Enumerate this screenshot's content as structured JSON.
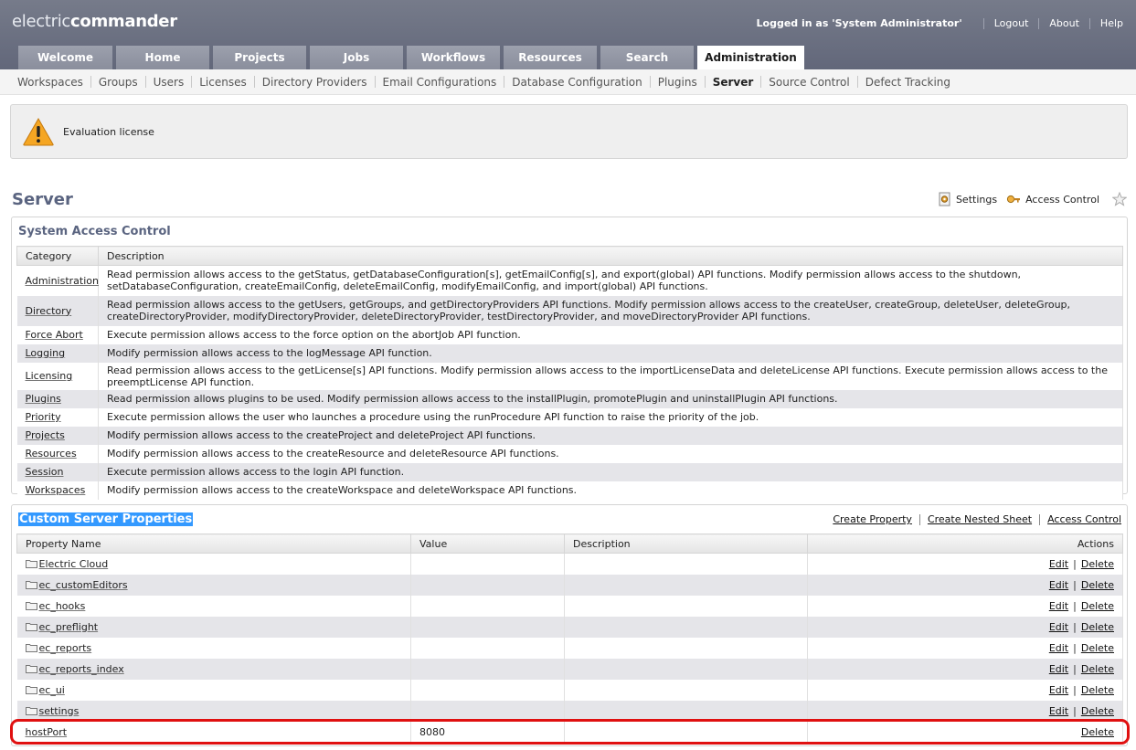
{
  "app": {
    "logo_light": "electric",
    "logo_bold": "commander"
  },
  "header": {
    "user_text": "Logged in as 'System Administrator'",
    "links": [
      "Logout",
      "About",
      "Help"
    ]
  },
  "tabs": [
    {
      "label": "Welcome",
      "active": false
    },
    {
      "label": "Home",
      "active": false
    },
    {
      "label": "Projects",
      "active": false
    },
    {
      "label": "Jobs",
      "active": false
    },
    {
      "label": "Workflows",
      "active": false
    },
    {
      "label": "Resources",
      "active": false
    },
    {
      "label": "Search",
      "active": false
    },
    {
      "label": "Administration",
      "active": true
    }
  ],
  "subnav": [
    {
      "label": "Workspaces",
      "active": false
    },
    {
      "label": "Groups",
      "active": false
    },
    {
      "label": "Users",
      "active": false
    },
    {
      "label": "Licenses",
      "active": false
    },
    {
      "label": "Directory Providers",
      "active": false
    },
    {
      "label": "Email Configurations",
      "active": false
    },
    {
      "label": "Database Configuration",
      "active": false
    },
    {
      "label": "Plugins",
      "active": false
    },
    {
      "label": "Server",
      "active": true
    },
    {
      "label": "Source Control",
      "active": false
    },
    {
      "label": "Defect Tracking",
      "active": false
    }
  ],
  "banner": {
    "message": "Evaluation license",
    "icon": "warning-icon"
  },
  "page": {
    "title": "Server",
    "settings_label": "Settings",
    "access_control_label": "Access Control"
  },
  "access": {
    "title": "System Access Control",
    "columns": [
      "Category",
      "Description"
    ],
    "rows": [
      {
        "category": "Administration",
        "description": "Read permission allows access to the getStatus, getDatabaseConfiguration[s], getEmailConfig[s], and export(global) API functions. Modify permission allows access to the shutdown, setDatabaseConfiguration, createEmailConfig, deleteEmailConfig, modifyEmailConfig, and import(global) API functions."
      },
      {
        "category": "Directory",
        "description": "Read permission allows access to the getUsers, getGroups, and getDirectoryProviders API functions. Modify permission allows access to the createUser, createGroup, deleteUser, deleteGroup, createDirectoryProvider, modifyDirectoryProvider, deleteDirectoryProvider, testDirectoryProvider, and moveDirectoryProvider API functions."
      },
      {
        "category": "Force Abort",
        "description": "Execute permission allows access to the force option on the abortJob API function."
      },
      {
        "category": "Logging",
        "description": "Modify permission allows access to the logMessage API function."
      },
      {
        "category": "Licensing",
        "description": "Read permission allows access to the getLicense[s] API functions. Modify permission allows access to the importLicenseData and deleteLicense API functions. Execute permission allows access to the preemptLicense API function."
      },
      {
        "category": "Plugins",
        "description": "Read permission allows plugins to be used. Modify permission allows access to the installPlugin, promotePlugin and uninstallPlugin API functions."
      },
      {
        "category": "Priority",
        "description": "Execute permission allows the user who launches a procedure using the runProcedure API function to raise the priority of the job."
      },
      {
        "category": "Projects",
        "description": "Modify permission allows access to the createProject and deleteProject API functions."
      },
      {
        "category": "Resources",
        "description": "Modify permission allows access to the createResource and deleteResource API functions."
      },
      {
        "category": "Session",
        "description": "Execute permission allows access to the login API function."
      },
      {
        "category": "Workspaces",
        "description": "Modify permission allows access to the createWorkspace and deleteWorkspace API functions."
      }
    ]
  },
  "properties": {
    "title": "Custom Server Properties",
    "actions": [
      "Create Property",
      "Create Nested Sheet",
      "Access Control"
    ],
    "columns": [
      "Property Name",
      "Value",
      "Description",
      "Actions"
    ],
    "edit_label": "Edit",
    "delete_label": "Delete",
    "rows": [
      {
        "name": "Electric Cloud",
        "value": "",
        "description": "",
        "folder": true
      },
      {
        "name": "ec_customEditors",
        "value": "",
        "description": "",
        "folder": true
      },
      {
        "name": "ec_hooks",
        "value": "",
        "description": "",
        "folder": true
      },
      {
        "name": "ec_preflight",
        "value": "",
        "description": "",
        "folder": true
      },
      {
        "name": "ec_reports",
        "value": "",
        "description": "",
        "folder": true
      },
      {
        "name": "ec_reports_index",
        "value": "",
        "description": "",
        "folder": true
      },
      {
        "name": "ec_ui",
        "value": "",
        "description": "",
        "folder": true
      },
      {
        "name": "settings",
        "value": "",
        "description": "",
        "folder": true
      },
      {
        "name": "hostPort",
        "value": "8080",
        "description": "",
        "folder": false
      }
    ]
  },
  "colors": {
    "header": "#6a6f7e",
    "title": "#5a6480",
    "highlight": "#3399ff",
    "outline": "#e01010"
  }
}
